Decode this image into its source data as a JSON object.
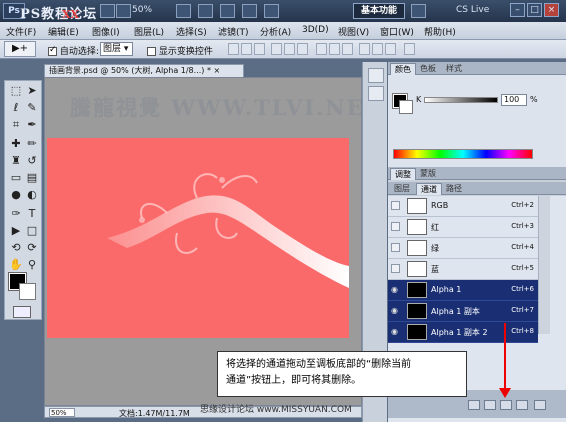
{
  "titlebar": {
    "logo": "Ps",
    "watermark": "PS教程论坛",
    "watermark_sub": "XX",
    "zoom": "50%",
    "workspace": "基本功能",
    "cs_live": "CS Live",
    "min": "–",
    "max": "□",
    "close": "×"
  },
  "menu": [
    "文件(F)",
    "编辑(E)",
    "图像(I)",
    "图层(L)",
    "选择(S)",
    "滤镜(T)",
    "分析(A)",
    "3D(D)",
    "视图(V)",
    "窗口(W)",
    "帮助(H)"
  ],
  "options": {
    "tool_icon": "▶+",
    "auto_select_label": "自动选择:",
    "auto_select_value": "图层",
    "show_transform_label": "显示变换控件"
  },
  "document": {
    "tab": "插画背景.psd @ 50% (大树, Alpha 1/8...) *",
    "close": "×",
    "canvas_watermark": "騰龍視覺 WWW.TLVI.NE",
    "zoom": "50%",
    "doc_size": "文档:1.47M/11.7M"
  },
  "color_panel": {
    "tabs": [
      "颜色",
      "色板",
      "样式"
    ],
    "channel_label": "K",
    "value": "100",
    "unit": "%"
  },
  "adjust_tabs": [
    "调整",
    "蒙版"
  ],
  "channels_panel": {
    "tabs": [
      "图层",
      "通道",
      "路径"
    ],
    "rows": [
      {
        "name": "RGB",
        "shortcut": "Ctrl+2",
        "selected": false
      },
      {
        "name": "红",
        "shortcut": "Ctrl+3",
        "selected": false
      },
      {
        "name": "绿",
        "shortcut": "Ctrl+4",
        "selected": false
      },
      {
        "name": "蓝",
        "shortcut": "Ctrl+5",
        "selected": false
      },
      {
        "name": "Alpha 1",
        "shortcut": "Ctrl+6",
        "selected": true
      },
      {
        "name": "Alpha 1 副本",
        "shortcut": "Ctrl+7",
        "selected": true
      },
      {
        "name": "Alpha 1 副本 2",
        "shortcut": "Ctrl+8",
        "selected": true
      }
    ]
  },
  "callout": {
    "text_line1": "将选择的通道拖动至调板底部的“删除当前",
    "text_line2": "通道”按钮上，即可将其删除。"
  },
  "bottom_watermark": "思缘设计论坛 www.MISSYUAN.COM",
  "colors": {
    "canvas": "#fb6a6a",
    "selected_row": "#1a2f73",
    "arrow": "#e00000"
  }
}
